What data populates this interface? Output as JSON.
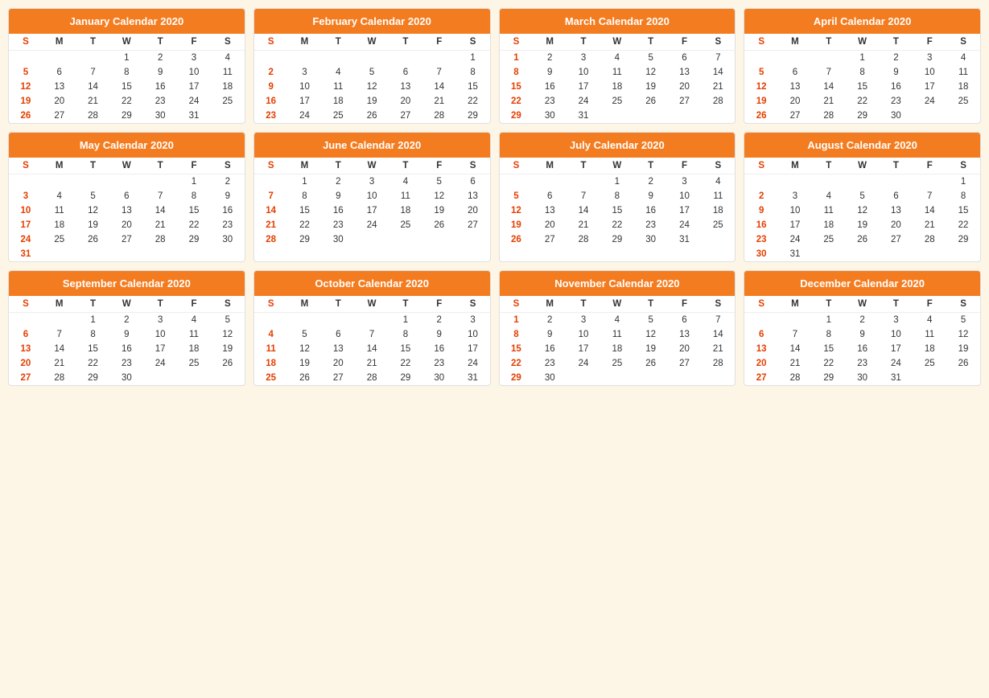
{
  "calendars": [
    {
      "id": "january",
      "title": "January Calendar 2020",
      "days_header": [
        "S",
        "M",
        "T",
        "W",
        "T",
        "F",
        "S"
      ],
      "weeks": [
        [
          "",
          "",
          "",
          "1",
          "2",
          "3",
          "4"
        ],
        [
          "5",
          "6",
          "7",
          "8",
          "9",
          "10",
          "11"
        ],
        [
          "12",
          "13",
          "14",
          "15",
          "16",
          "17",
          "18"
        ],
        [
          "19",
          "20",
          "21",
          "22",
          "23",
          "24",
          "25"
        ],
        [
          "26",
          "27",
          "28",
          "29",
          "30",
          "31",
          ""
        ]
      ]
    },
    {
      "id": "february",
      "title": "February Calendar 2020",
      "days_header": [
        "S",
        "M",
        "T",
        "W",
        "T",
        "F",
        "S"
      ],
      "weeks": [
        [
          "",
          "",
          "",
          "",
          "",
          "",
          "1"
        ],
        [
          "2",
          "3",
          "4",
          "5",
          "6",
          "7",
          "8"
        ],
        [
          "9",
          "10",
          "11",
          "12",
          "13",
          "14",
          "15"
        ],
        [
          "16",
          "17",
          "18",
          "19",
          "20",
          "21",
          "22"
        ],
        [
          "23",
          "24",
          "25",
          "26",
          "27",
          "28",
          "29"
        ]
      ]
    },
    {
      "id": "march",
      "title": "March Calendar 2020",
      "days_header": [
        "S",
        "M",
        "T",
        "W",
        "T",
        "F",
        "S"
      ],
      "weeks": [
        [
          "1",
          "2",
          "3",
          "4",
          "5",
          "6",
          "7"
        ],
        [
          "8",
          "9",
          "10",
          "11",
          "12",
          "13",
          "14"
        ],
        [
          "15",
          "16",
          "17",
          "18",
          "19",
          "20",
          "21"
        ],
        [
          "22",
          "23",
          "24",
          "25",
          "26",
          "27",
          "28"
        ],
        [
          "29",
          "30",
          "31",
          "",
          "",
          "",
          ""
        ]
      ]
    },
    {
      "id": "april",
      "title": "April Calendar 2020",
      "days_header": [
        "S",
        "M",
        "T",
        "W",
        "T",
        "F",
        "S"
      ],
      "weeks": [
        [
          "",
          "",
          "",
          "1",
          "2",
          "3",
          "4"
        ],
        [
          "5",
          "6",
          "7",
          "8",
          "9",
          "10",
          "11"
        ],
        [
          "12",
          "13",
          "14",
          "15",
          "16",
          "17",
          "18"
        ],
        [
          "19",
          "20",
          "21",
          "22",
          "23",
          "24",
          "25"
        ],
        [
          "26",
          "27",
          "28",
          "29",
          "30",
          "",
          ""
        ]
      ]
    },
    {
      "id": "may",
      "title": "May Calendar 2020",
      "days_header": [
        "S",
        "M",
        "T",
        "W",
        "T",
        "F",
        "S"
      ],
      "weeks": [
        [
          "",
          "",
          "",
          "",
          "",
          "1",
          "2"
        ],
        [
          "3",
          "4",
          "5",
          "6",
          "7",
          "8",
          "9"
        ],
        [
          "10",
          "11",
          "12",
          "13",
          "14",
          "15",
          "16"
        ],
        [
          "17",
          "18",
          "19",
          "20",
          "21",
          "22",
          "23"
        ],
        [
          "24",
          "25",
          "26",
          "27",
          "28",
          "29",
          "30"
        ],
        [
          "31",
          "",
          "",
          "",
          "",
          "",
          ""
        ]
      ]
    },
    {
      "id": "june",
      "title": "June Calendar 2020",
      "days_header": [
        "S",
        "M",
        "T",
        "W",
        "T",
        "F",
        "S"
      ],
      "weeks": [
        [
          "",
          "1",
          "2",
          "3",
          "4",
          "5",
          "6"
        ],
        [
          "7",
          "8",
          "9",
          "10",
          "11",
          "12",
          "13"
        ],
        [
          "14",
          "15",
          "16",
          "17",
          "18",
          "19",
          "20"
        ],
        [
          "21",
          "22",
          "23",
          "24",
          "25",
          "26",
          "27"
        ],
        [
          "28",
          "29",
          "30",
          "",
          "",
          "",
          ""
        ]
      ]
    },
    {
      "id": "july",
      "title": "July Calendar 2020",
      "days_header": [
        "S",
        "M",
        "T",
        "W",
        "T",
        "F",
        "S"
      ],
      "weeks": [
        [
          "",
          "",
          "",
          "1",
          "2",
          "3",
          "4"
        ],
        [
          "5",
          "6",
          "7",
          "8",
          "9",
          "10",
          "11"
        ],
        [
          "12",
          "13",
          "14",
          "15",
          "16",
          "17",
          "18"
        ],
        [
          "19",
          "20",
          "21",
          "22",
          "23",
          "24",
          "25"
        ],
        [
          "26",
          "27",
          "28",
          "29",
          "30",
          "31",
          ""
        ]
      ]
    },
    {
      "id": "august",
      "title": "August Calendar 2020",
      "days_header": [
        "S",
        "M",
        "T",
        "W",
        "T",
        "F",
        "S"
      ],
      "weeks": [
        [
          "",
          "",
          "",
          "",
          "",
          "",
          "1"
        ],
        [
          "2",
          "3",
          "4",
          "5",
          "6",
          "7",
          "8"
        ],
        [
          "9",
          "10",
          "11",
          "12",
          "13",
          "14",
          "15"
        ],
        [
          "16",
          "17",
          "18",
          "19",
          "20",
          "21",
          "22"
        ],
        [
          "23",
          "24",
          "25",
          "26",
          "27",
          "28",
          "29"
        ],
        [
          "30",
          "31",
          "",
          "",
          "",
          "",
          ""
        ]
      ]
    },
    {
      "id": "september",
      "title": "September Calendar 2020",
      "days_header": [
        "S",
        "M",
        "T",
        "W",
        "T",
        "F",
        "S"
      ],
      "weeks": [
        [
          "",
          "",
          "1",
          "2",
          "3",
          "4",
          "5"
        ],
        [
          "6",
          "7",
          "8",
          "9",
          "10",
          "11",
          "12"
        ],
        [
          "13",
          "14",
          "15",
          "16",
          "17",
          "18",
          "19"
        ],
        [
          "20",
          "21",
          "22",
          "23",
          "24",
          "25",
          "26"
        ],
        [
          "27",
          "28",
          "29",
          "30",
          "",
          "",
          ""
        ]
      ]
    },
    {
      "id": "october",
      "title": "October Calendar 2020",
      "days_header": [
        "S",
        "M",
        "T",
        "W",
        "T",
        "F",
        "S"
      ],
      "weeks": [
        [
          "",
          "",
          "",
          "",
          "1",
          "2",
          "3"
        ],
        [
          "4",
          "5",
          "6",
          "7",
          "8",
          "9",
          "10"
        ],
        [
          "11",
          "12",
          "13",
          "14",
          "15",
          "16",
          "17"
        ],
        [
          "18",
          "19",
          "20",
          "21",
          "22",
          "23",
          "24"
        ],
        [
          "25",
          "26",
          "27",
          "28",
          "29",
          "30",
          "31"
        ]
      ]
    },
    {
      "id": "november",
      "title": "November Calendar 2020",
      "days_header": [
        "S",
        "M",
        "T",
        "W",
        "T",
        "F",
        "S"
      ],
      "weeks": [
        [
          "1",
          "2",
          "3",
          "4",
          "5",
          "6",
          "7"
        ],
        [
          "8",
          "9",
          "10",
          "11",
          "12",
          "13",
          "14"
        ],
        [
          "15",
          "16",
          "17",
          "18",
          "19",
          "20",
          "21"
        ],
        [
          "22",
          "23",
          "24",
          "25",
          "26",
          "27",
          "28"
        ],
        [
          "29",
          "30",
          "",
          "",
          "",
          "",
          ""
        ]
      ]
    },
    {
      "id": "december",
      "title": "December Calendar 2020",
      "days_header": [
        "S",
        "M",
        "T",
        "W",
        "T",
        "F",
        "S"
      ],
      "weeks": [
        [
          "",
          "",
          "1",
          "2",
          "3",
          "4",
          "5"
        ],
        [
          "6",
          "7",
          "8",
          "9",
          "10",
          "11",
          "12"
        ],
        [
          "13",
          "14",
          "15",
          "16",
          "17",
          "18",
          "19"
        ],
        [
          "20",
          "21",
          "22",
          "23",
          "24",
          "25",
          "26"
        ],
        [
          "27",
          "28",
          "29",
          "30",
          "31",
          "",
          ""
        ]
      ]
    }
  ]
}
